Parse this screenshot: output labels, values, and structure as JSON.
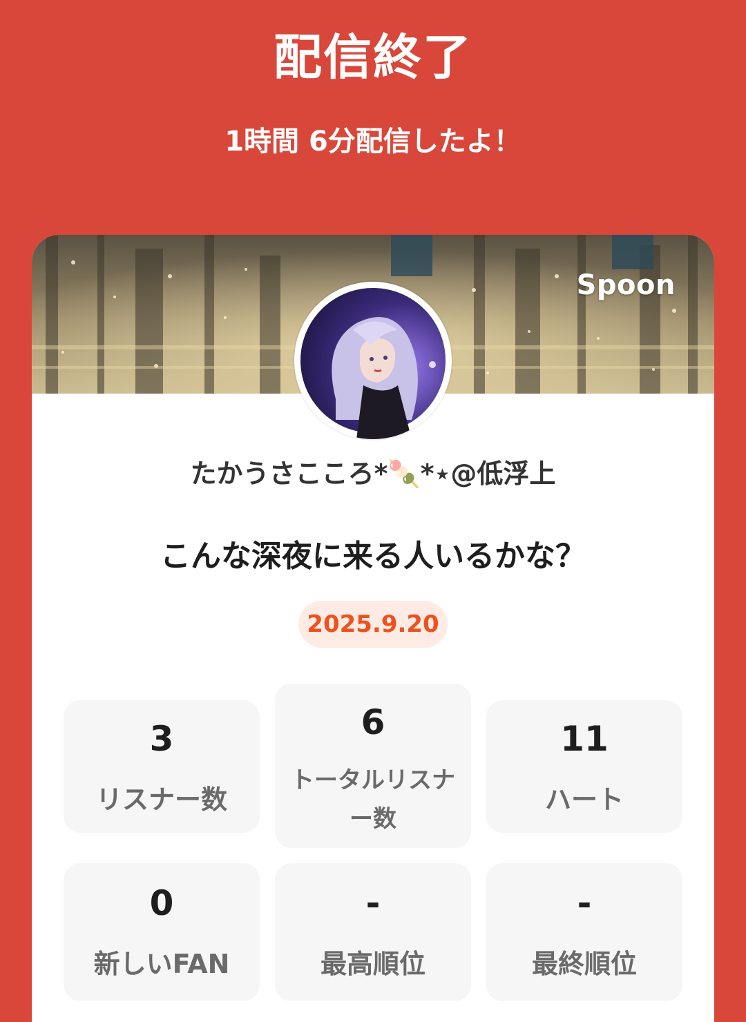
{
  "header": {
    "title": "配信終了",
    "duration_text": "1時間 6分配信したよ！"
  },
  "card": {
    "brand": "Spoon",
    "username": "たかうさこころ*🍡*⋆@低浮上",
    "stream_title": "こんな深夜に来る人いるかな？",
    "date": "2025.9.20"
  },
  "stats": [
    {
      "value": "3",
      "label": "リスナー数"
    },
    {
      "value": "6",
      "label": "トータルリスナー数"
    },
    {
      "value": "11",
      "label": "ハート"
    },
    {
      "value": "0",
      "label": "新しいFAN"
    },
    {
      "value": "-",
      "label": "最高順位"
    },
    {
      "value": "-",
      "label": "最終順位"
    }
  ],
  "colors": {
    "background": "#D9473A",
    "accent": "#F0501E",
    "badge_bg": "#FDEBE4",
    "tile_bg": "#F6F6F6"
  }
}
